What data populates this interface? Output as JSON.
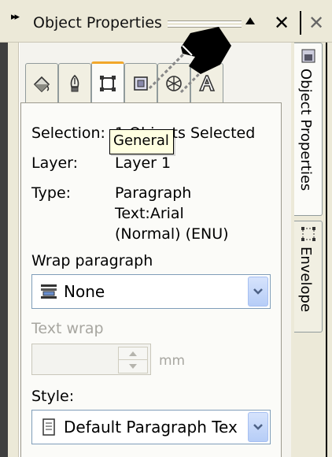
{
  "titlebar": {
    "grip": "▸▸",
    "title": "Object Properties",
    "close_symbol": "✕",
    "close_symbol_2": "✕"
  },
  "tabs": [
    {
      "icon": "fill-icon",
      "glyph": "⬟",
      "active": false
    },
    {
      "icon": "outline-pen-icon",
      "glyph": "✎",
      "active": false
    },
    {
      "icon": "general-icon",
      "glyph": "□",
      "active": true
    },
    {
      "icon": "detail-icon",
      "glyph": "▣",
      "active": false
    },
    {
      "icon": "internet-icon",
      "glyph": "⌘",
      "active": false
    },
    {
      "icon": "text-icon",
      "glyph": "A",
      "active": false
    }
  ],
  "tooltip": "General",
  "properties": {
    "selection_label": "Selection:",
    "selection_value": "1 Objects Selected",
    "layer_label": "Layer:",
    "layer_value": "Layer 1",
    "type_label": "Type:",
    "type_value_line1": "Paragraph",
    "type_value_line2": "Text:Arial",
    "type_value_line3": "(Normal) (ENU)"
  },
  "wrap_paragraph": {
    "label": "Wrap paragraph",
    "value": "None"
  },
  "text_wrap": {
    "label": "Text wrap",
    "value": "",
    "unit": "mm"
  },
  "style": {
    "label": "Style:",
    "value": "Default Paragraph Tex"
  },
  "side_tabs": {
    "object_properties": "Object Properties",
    "envelope": "Envelope"
  },
  "colors": {
    "active_tab_accent": "#f1a72b",
    "combo_button": "#b6cdf7",
    "tooltip_bg": "#ffffe1",
    "disabled_text": "#a7a6a0"
  }
}
